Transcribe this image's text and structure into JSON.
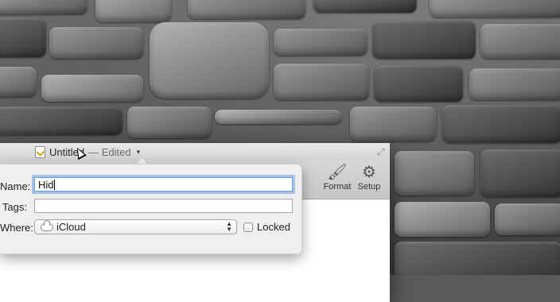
{
  "window": {
    "title": "Untitled",
    "edited_status": "— Edited",
    "title_menu_caret": "▾"
  },
  "toolbar": {
    "format_label": "Format",
    "setup_label": "Setup",
    "format_icon": "paintbrush-icon",
    "setup_icon": "gear-icon"
  },
  "popover": {
    "name_label": "Name:",
    "name_value": "Hid",
    "tags_label": "Tags:",
    "tags_value": "",
    "where_label": "Where:",
    "where_value": "iCloud",
    "where_icon": "cloud-icon",
    "locked_label": "Locked",
    "locked_checked": false
  },
  "colors": {
    "focus_ring": "#689CDC",
    "window_bg": "#ECECEC"
  }
}
